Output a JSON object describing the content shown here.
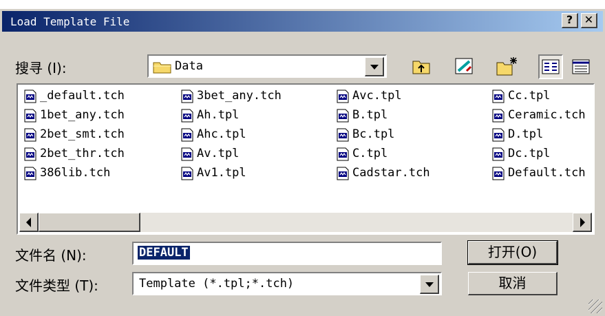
{
  "window": {
    "title": "Load Template File",
    "help_label": "?",
    "close_label": "✕"
  },
  "lookin": {
    "label": "搜寻 (I):",
    "value": "Data",
    "toolbar": [
      "up-folder-icon",
      "desktop-icon",
      "new-folder-icon",
      "list-view-icon",
      "details-view-icon"
    ]
  },
  "files": [
    "_default.tch",
    "1bet_any.tch",
    "2bet_smt.tch",
    "2bet_thr.tch",
    "386lib.tch",
    "3bet_any.tch",
    "Ah.tpl",
    "Ahc.tpl",
    "Av.tpl",
    "Av1.tpl",
    "Avc.tpl",
    "B.tpl",
    "Bc.tpl",
    "C.tpl",
    "Cadstar.tch",
    "Cc.tpl",
    "Ceramic.tch",
    "D.tpl",
    "Dc.tpl",
    "Default.tch"
  ],
  "filename": {
    "label": "文件名 (N):",
    "value": "DEFAULT"
  },
  "filetype": {
    "label": "文件类型 (T):",
    "value": "Template (*.tpl;*.tch)"
  },
  "buttons": {
    "open": "打开(O)",
    "cancel": "取消"
  },
  "colors": {
    "title_start": "#0a246a",
    "title_end": "#a6caf0",
    "face": "#d4d0c8",
    "selection": "#0a246a"
  }
}
